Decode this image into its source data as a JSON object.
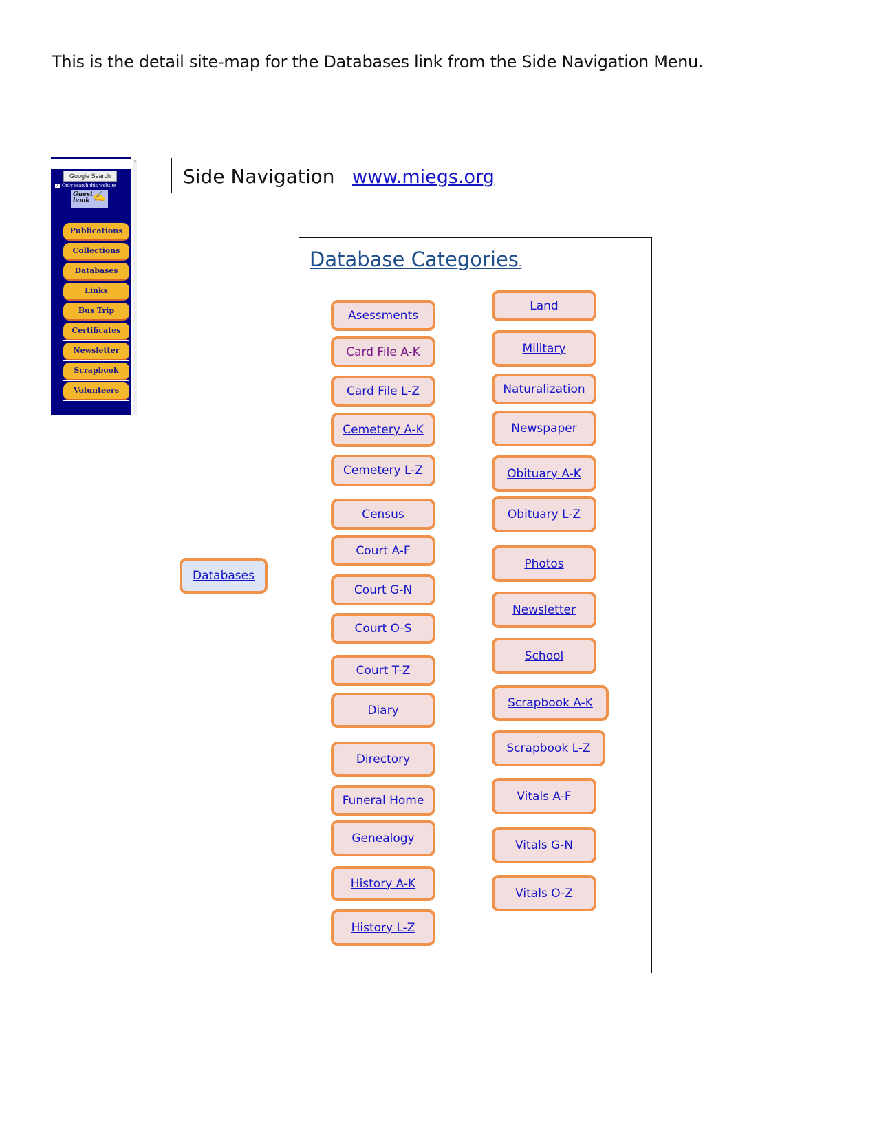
{
  "intro": "This is the detail site-map for the Databases link from the Side Navigation Menu.",
  "side_nav": {
    "search_button": "Google Search",
    "only_search_label": "Only search this website",
    "only_search_checked": true,
    "guestbook": [
      "Guest",
      "book"
    ],
    "items": [
      "Publications",
      "Collections",
      "Databases",
      "Links",
      "Bus Trip",
      "Certificates",
      "Newsletter",
      "Scrapbook",
      "Volunteers"
    ]
  },
  "header_box": {
    "label": "Side Navigation",
    "url": "www.miegs.org"
  },
  "origin_button": "Databases",
  "categories": {
    "title": "Database Categories",
    "title_suffix": ".",
    "left": [
      {
        "label": "Asessments",
        "link": false
      },
      {
        "label": "Card File A-K",
        "link": false,
        "visited": true
      },
      {
        "label": "Card File L-Z",
        "link": false
      },
      {
        "label": "Cemetery A-K",
        "link": true
      },
      {
        "label": "Cemetery L-Z",
        "link": true
      },
      {
        "label": "Census",
        "link": false
      },
      {
        "label": "Court A-F",
        "link": false
      },
      {
        "label": "Court G-N",
        "link": false
      },
      {
        "label": "Court O-S",
        "link": false
      },
      {
        "label": "Court T-Z",
        "link": false
      },
      {
        "label": "Diary",
        "link": true
      },
      {
        "label": "Directory",
        "link": true
      },
      {
        "label": "Funeral Home",
        "link": false
      },
      {
        "label": "Genealogy",
        "link": true
      },
      {
        "label": "History A-K",
        "link": true
      },
      {
        "label": "History L-Z",
        "link": true
      }
    ],
    "right": [
      {
        "label": "Land",
        "link": false
      },
      {
        "label": "Military",
        "link": true
      },
      {
        "label": "Naturalization",
        "link": false
      },
      {
        "label": "Newspaper",
        "link": true
      },
      {
        "label": "Obituary A-K",
        "link": true
      },
      {
        "label": "Obituary L-Z",
        "link": true
      },
      {
        "label": "Photos",
        "link": true
      },
      {
        "label": "Newsletter",
        "link": true
      },
      {
        "label": "School",
        "link": true
      },
      {
        "label": "Scrapbook A-K",
        "link": true
      },
      {
        "label": "Scrapbook L-Z",
        "link": true
      },
      {
        "label": "Vitals A-F",
        "link": true
      },
      {
        "label": "Vitals G-N",
        "link": true
      },
      {
        "label": "Vitals O-Z",
        "link": true
      }
    ]
  }
}
